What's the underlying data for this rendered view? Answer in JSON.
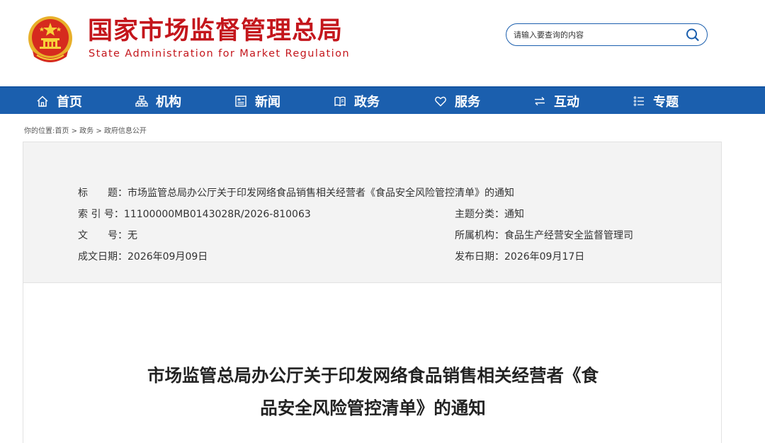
{
  "header": {
    "site_name": "国家市场监督管理总局",
    "site_name_en": "State Administration for Market Regulation",
    "search": {
      "placeholder": "请输入要查询的内容",
      "value": ""
    }
  },
  "colors": {
    "brand_red": "#c4161c",
    "nav_blue": "#1b5fae",
    "panel_gray": "#f3f3f3"
  },
  "nav": {
    "items": [
      {
        "label": "首页",
        "icon": "home-icon"
      },
      {
        "label": "机构",
        "icon": "org-chart-icon"
      },
      {
        "label": "新闻",
        "icon": "newspaper-icon"
      },
      {
        "label": "政务",
        "icon": "open-book-icon"
      },
      {
        "label": "服务",
        "icon": "heart-icon"
      },
      {
        "label": "互动",
        "icon": "swap-arrows-icon"
      },
      {
        "label": "专题",
        "icon": "list-icon"
      }
    ]
  },
  "breadcrumb": {
    "prefix": "你的位置:",
    "items": [
      "首页",
      "政务",
      "政府信息公开"
    ],
    "separator": ">"
  },
  "info": {
    "title_label": "标　　题：",
    "title_value": "市场监管总局办公厅关于印发网络食品销售相关经营者《食品安全风险管控清单》的通知",
    "index_label": "索 引 号：",
    "index_value": "11100000MB0143028R/2026-810063",
    "category_label": "主题分类：",
    "category_value": "通知",
    "doc_no_label": "文　　号：",
    "doc_no_value": "无",
    "org_label": "所属机构：",
    "org_value": "食品生产经营安全监督管理司",
    "created_label": "成文日期：",
    "created_value": "2026年09月09日",
    "published_label": "发布日期：",
    "published_value": "2026年09月17日"
  },
  "article": {
    "title_line1": "市场监管总局办公厅关于印发网络食品销售相关经营者《食",
    "title_line2": "品安全风险管控清单》的通知"
  }
}
